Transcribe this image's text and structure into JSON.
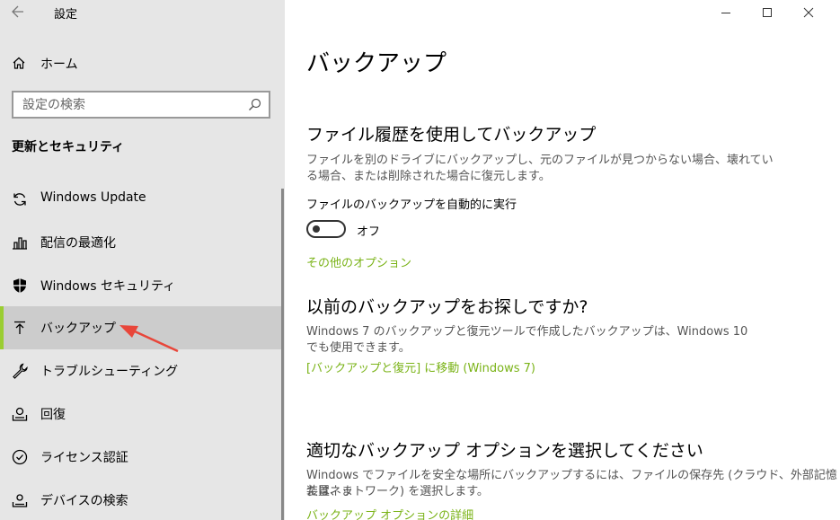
{
  "window": {
    "title": "設定"
  },
  "sidebar": {
    "home_label": "ホーム",
    "search_placeholder": "設定の検索",
    "section_title": "更新とセキュリティ",
    "items": [
      {
        "label": "Windows Update",
        "icon": "sync-icon"
      },
      {
        "label": "配信の最適化",
        "icon": "delivery-optimization-icon"
      },
      {
        "label": "Windows セキュリティ",
        "icon": "shield-icon"
      },
      {
        "label": "バックアップ",
        "icon": "backup-arrow-icon",
        "selected": true
      },
      {
        "label": "トラブルシューティング",
        "icon": "wrench-icon"
      },
      {
        "label": "回復",
        "icon": "recovery-icon"
      },
      {
        "label": "ライセンス認証",
        "icon": "checkmark-circle-icon"
      },
      {
        "label": "デバイスの検索",
        "icon": "find-device-icon"
      }
    ]
  },
  "main": {
    "title": "バックアップ",
    "file_history": {
      "heading": "ファイル履歴を使用してバックアップ",
      "description_line1": "ファイルを別のドライブにバックアップし、元のファイルが見つからない場合、壊れてい",
      "description_line2": "る場合、または削除された場合に復元します。",
      "toggle_label": "ファイルのバックアップを自動的に実行",
      "toggle_state": "オフ",
      "more_options_link": "その他のオプション"
    },
    "older_backup": {
      "heading": "以前のバックアップをお探しですか?",
      "description_line1": "Windows 7 のバックアップと復元ツールで作成したバックアップは、Windows 10",
      "description_line2": "でも使用できます。",
      "link": "[バックアップと復元] に移動 (Windows 7)"
    },
    "choose_option": {
      "heading": "適切なバックアップ オプションを選択してください",
      "description_line1": "Windows でファイルを安全な場所にバックアップするには、ファイルの保存先 (クラウド、外部記憶装置、ま",
      "description_line2": "たはネットワーク) を選択します。",
      "link": "バックアップ オプションの詳細"
    }
  },
  "colors": {
    "accent": "#7ab317",
    "sidebar_bg": "#e6e6e6",
    "selected_bg": "#cccccc",
    "annotation_arrow": "#e8463a"
  }
}
